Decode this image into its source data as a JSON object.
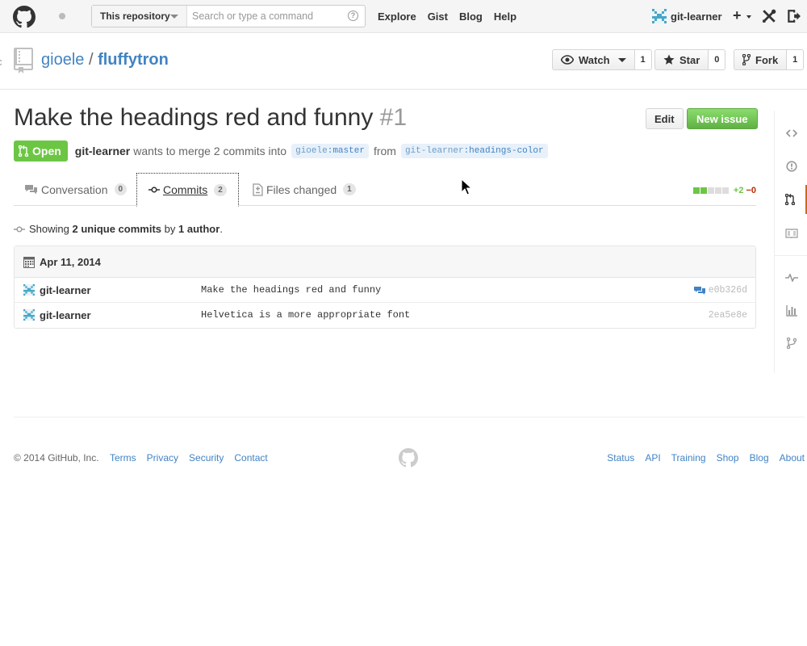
{
  "header": {
    "search_scope": "This repository",
    "search_placeholder": "Search or type a command",
    "help_label": "?",
    "nav": [
      "Explore",
      "Gist",
      "Blog",
      "Help"
    ],
    "user": "git-learner",
    "plus_label": "+"
  },
  "repo": {
    "cut_text": "c",
    "owner": "gioele",
    "separator": "/",
    "name": "fluffytron",
    "watch_label": "Watch",
    "watch_count": "1",
    "star_label": "Star",
    "star_count": "0",
    "fork_label": "Fork",
    "fork_count": "1"
  },
  "pr": {
    "title": "Make the headings red and funny",
    "number": "#1",
    "edit_label": "Edit",
    "new_issue_label": "New issue",
    "state": "Open",
    "author": "git-learner",
    "merge_text": "wants to merge 2 commits into",
    "base_user": "gioele",
    "base_branch": "master",
    "from_text": "from",
    "head_user": "git-learner",
    "head_branch": "headings-color",
    "ref_sep": ":"
  },
  "tabs": [
    {
      "label": "Conversation",
      "count": "0"
    },
    {
      "label": "Commits",
      "count": "2"
    },
    {
      "label": "Files changed",
      "count": "1"
    }
  ],
  "diffstat": {
    "additions": "+2",
    "deletions": "−0",
    "add_color": "#6cc644",
    "del_color": "#bd2c00"
  },
  "commits_info": {
    "showing": "Showing",
    "unique": "2 unique commits",
    "by": "by",
    "author": "1 author",
    "period": "."
  },
  "commit_group": {
    "date": "Apr 11, 2014",
    "rows": [
      {
        "author": "git-learner",
        "message": "Make the headings red and funny",
        "sha": "e0b326d",
        "has_comment": true
      },
      {
        "author": "git-learner",
        "message": "Helvetica is a more appropriate font",
        "sha": "2ea5e8e",
        "has_comment": false
      }
    ]
  },
  "sidebar_icons": [
    "code-icon",
    "issues-icon",
    "pull-requests-icon",
    "wiki-icon",
    "pulse-icon",
    "graphs-icon",
    "network-icon"
  ],
  "footer": {
    "copyright": "© 2014 GitHub, Inc.",
    "left_links": [
      "Terms",
      "Privacy",
      "Security",
      "Contact"
    ],
    "right_links": [
      "Status",
      "API",
      "Training",
      "Shop",
      "Blog",
      "About"
    ]
  },
  "colors": {
    "link": "#4183c4",
    "open_green": "#6cc644",
    "accent_orange": "#d26911"
  }
}
